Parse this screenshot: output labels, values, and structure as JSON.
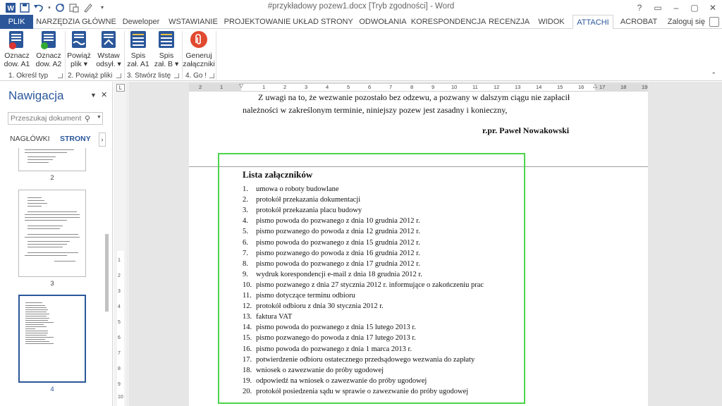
{
  "window": {
    "title": "#przykładowy pozew1.docx [Tryb zgodności] - Word",
    "controls": [
      "?",
      "▭",
      "–",
      "▢",
      "✕"
    ]
  },
  "qat": {
    "icons": [
      "word-icon",
      "save-icon",
      "undo-icon",
      "redo-icon",
      "repeat-icon",
      "format-painter-icon",
      "customize-icon"
    ]
  },
  "tabs": [
    "PLIK",
    "NARZĘDZIA GŁÓWNE",
    "Deweloper",
    "WSTAWIANIE",
    "PROJEKTOWANIE",
    "UKŁAD STRONY",
    "ODWOŁANIA",
    "KORESPONDENCJA",
    "RECENZJA",
    "WIDOK",
    "ATTACHI",
    "ACROBAT"
  ],
  "active_tab": "ATTACHI",
  "signin": "Zaloguj się",
  "ribbon": {
    "buttons": [
      {
        "line1": "Oznacz",
        "line2": "dow. A1",
        "color": "#2b579a"
      },
      {
        "line1": "Oznacz",
        "line2": "dow. A2",
        "color": "#2b579a"
      },
      {
        "line1": "Powiąż",
        "line2": "plik ▾",
        "color": "#2b579a"
      },
      {
        "line1": "Wstaw",
        "line2": "odsył. ▾",
        "color": "#2b579a"
      },
      {
        "line1": "Spis",
        "line2": "zał. A1",
        "color": "#2b579a"
      },
      {
        "line1": "Spis",
        "line2": "zał. B ▾",
        "color": "#2b579a"
      },
      {
        "line1": "Generuj",
        "line2": "załączniki",
        "color": "#e04a2f"
      }
    ],
    "groups": [
      "1. Określ typ",
      "2. Powiąż pliki",
      "3. Stwórz listę",
      "4. Go !"
    ]
  },
  "nav": {
    "title": "Nawigacja",
    "search_placeholder": "Przeszukaj dokument",
    "tabs": [
      "NAGŁÓWKI",
      "STRONY"
    ],
    "active_tab": "STRONY",
    "pages": [
      "2",
      "3",
      "4"
    ]
  },
  "ruler": {
    "h_labels": [
      "2",
      "1",
      "1",
      "2",
      "3",
      "4",
      "5",
      "6",
      "7",
      "8",
      "9",
      "10",
      "11",
      "12",
      "13",
      "14",
      "15",
      "16",
      "17",
      "18",
      "19"
    ],
    "v_labels": [
      "1",
      "2",
      "3",
      "4",
      "5",
      "6",
      "7",
      "8",
      "9",
      "10",
      "11"
    ]
  },
  "document": {
    "para_line1": "Z uwagi na to, że wezwanie pozostało bez odzewu, a pozwany w dalszym ciągu nie zapłacił",
    "para_line2": "należności w zakreślonym terminie, niniejszy pozew jest zasadny i konieczny,",
    "signature": "r.pr. Paweł  Nowakowski",
    "list_title": "Lista załączników",
    "attachments": [
      "umowa o roboty budowlane",
      "protokół przekazania dokumentacji",
      "protokół przekazania placu budowy",
      "pismo powoda do pozwanego z dnia 10 grudnia 2012 r.",
      "pismo pozwanego do powoda z dnia 12 grudnia 2012 r.",
      "pismo powoda do pozwanego z dnia 15 grudnia 2012 r.",
      "pismo pozwanego do powoda z dnia 16 grudnia 2012 r.",
      "pismo powoda do pozwanego z dnia 17 grudnia 2012 r.",
      "wydruk korespondencji e-mail z dnia 18 grudnia 2012 r.",
      "pismo pozwanego z dnia 27 stycznia 2012 r. informujące o zakończeniu prac",
      "pismo dotyczące terminu odbioru",
      "protokół odbioru z dnia 30 stycznia 2012 r.",
      "faktura VAT",
      "pismo powoda do pozwanego z dnia 15 lutego 2013 r.",
      "pismo pozwanego do powoda z dnia 17 lutego 2013 r.",
      "pismo powoda do pozwanego z dnia 1 marca 2013 r.",
      "potwierdzenie odbioru ostatecznego przedsądowego wezwania do zapłaty",
      "wniosek o zawezwanie do próby ugodowej",
      "odpowiedź na wniosek o zawezwanie do próby ugodowej",
      "protokół posiedzenia sądu w sprawie o zawezwanie do próby ugodowej"
    ]
  },
  "colors": {
    "brand": "#2b579a",
    "highlight": "#4cd44c",
    "generate": "#e04a2f"
  }
}
